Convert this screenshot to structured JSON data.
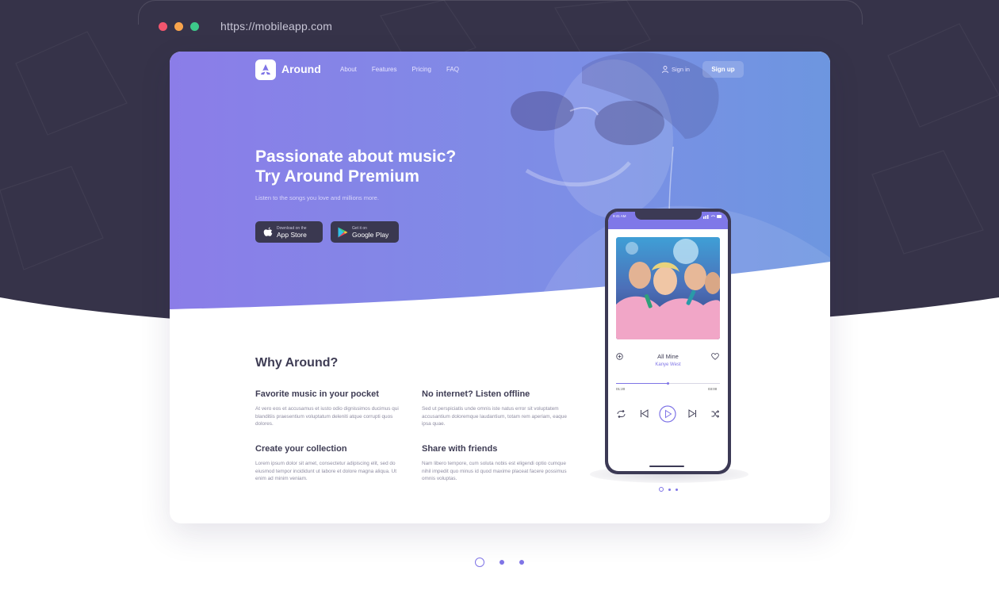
{
  "browser": {
    "url": "https://mobileapp.com",
    "dot_colors": [
      "#f2566e",
      "#f8a44c",
      "#3dc98a"
    ]
  },
  "nav": {
    "logo_text": "Around",
    "links": [
      "About",
      "Features",
      "Pricing",
      "FAQ"
    ],
    "signin_label": "Sign in",
    "signup_label": "Sign up"
  },
  "hero": {
    "title_line1": "Passionate about music?",
    "title_line2": "Try Around Premium",
    "subtitle": "Listen to the songs you love and millions more.",
    "appstore_small": "Download on the",
    "appstore_large": "App Store",
    "googleplay_small": "Get it on",
    "googleplay_large": "Google Play"
  },
  "why": {
    "heading": "Why Around?",
    "features": [
      {
        "title": "Favorite music in your pocket",
        "text": "At vero eos et accusamus et iusto odio dignissimos ducimus qui blanditiis praesentium voluptatum deleniti atque corrupti quos dolores."
      },
      {
        "title": "No internet? Listen offline",
        "text": "Sed ut perspiciatis unde omnis iste natus error sit voluptatem accusantium doloremque laudantium, totam rem aperiam, eaque ipsa quae."
      },
      {
        "title": "Create your collection",
        "text": "Lorem ipsum dolor sit amet, consectetur adipiscing elit, sed do eiusmod tempor incididunt ut labore et dolore magna aliqua. Ut enim ad minim veniam."
      },
      {
        "title": "Share with friends",
        "text": "Nam libero tempore, cum soluta nobis est eligendi optio cumque nihil impedit quo minus id quod maxime placeat facere possimus omnis voluptas."
      }
    ]
  },
  "player": {
    "status_time": "9:41 AM",
    "song_title": "All Mine",
    "artist": "Kanye West",
    "elapsed": "01:20",
    "total": "03:00",
    "progress": 0.5
  },
  "carousel": {
    "inner_active_index": 0,
    "outer_active_index": 0,
    "slide_count": 3
  },
  "colors": {
    "accent": "#7f74e6",
    "dark_bg": "#363349",
    "hero_start": "#8b7de8",
    "hero_end": "#6d96e0"
  }
}
